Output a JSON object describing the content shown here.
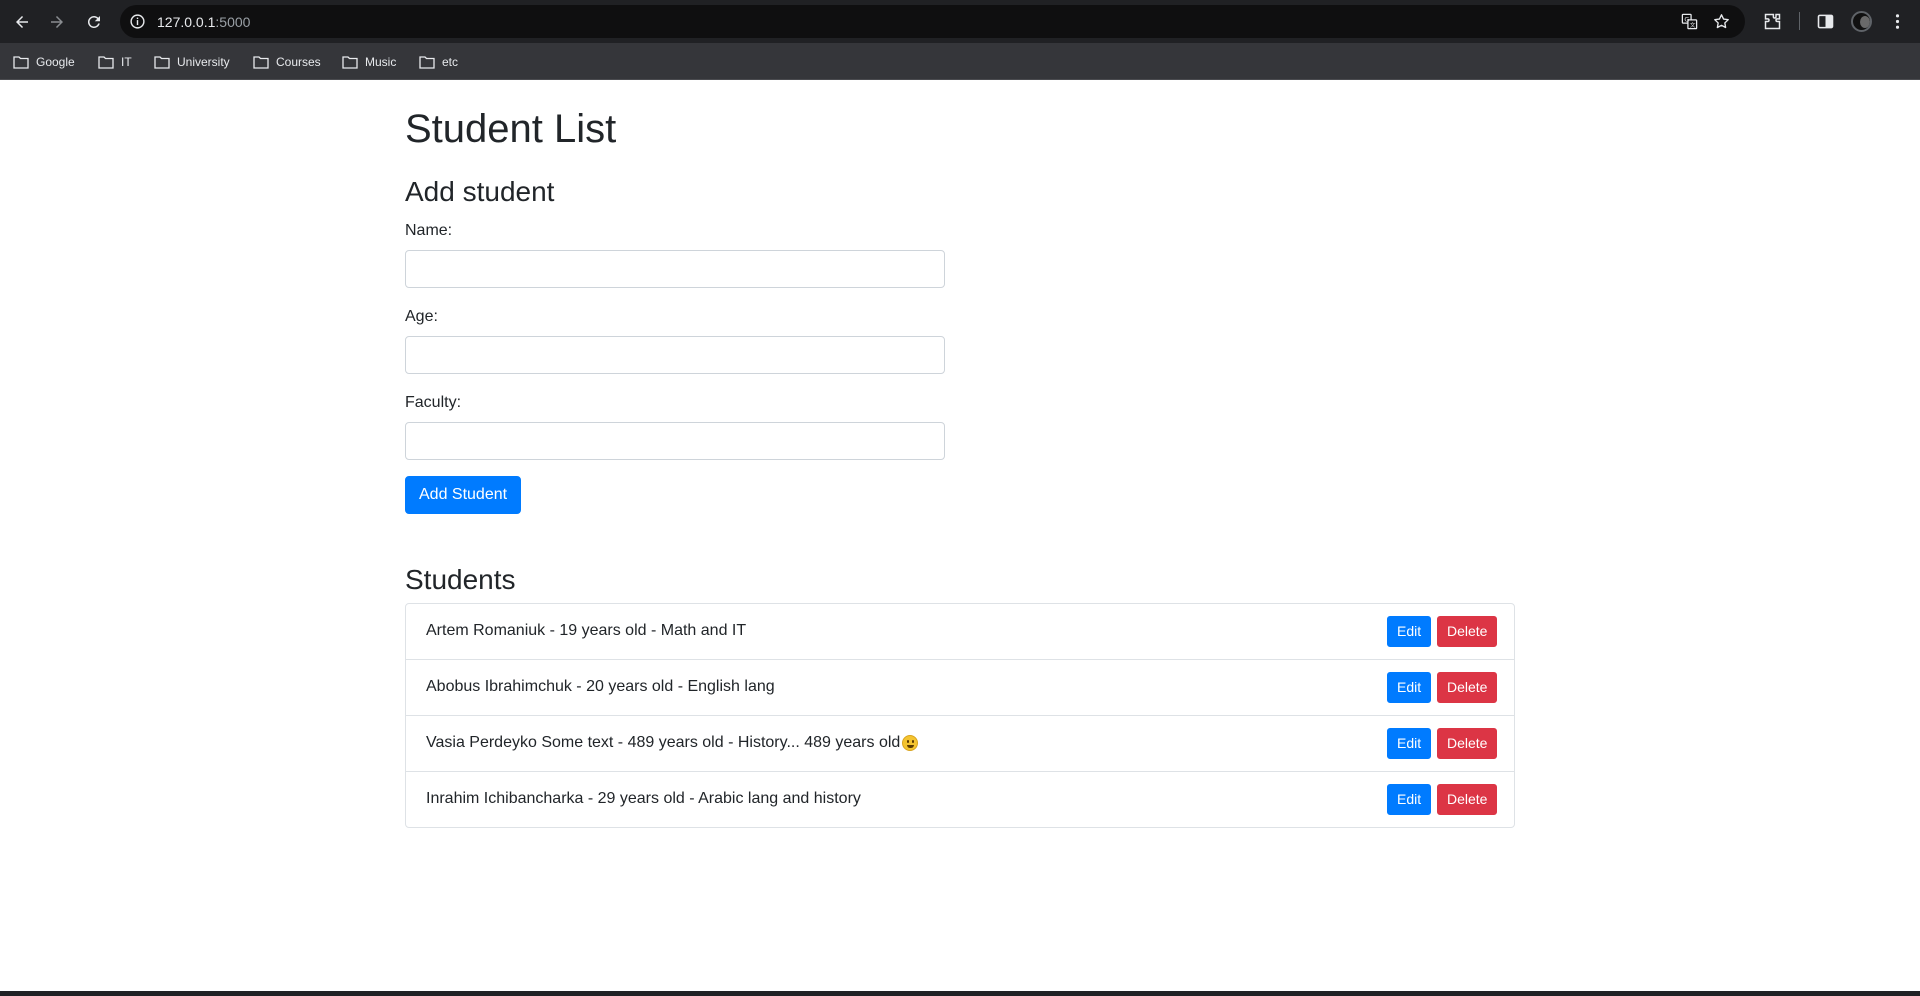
{
  "browser": {
    "url_host": "127.0.0.1",
    "url_port": ":5000",
    "bookmarks": [
      {
        "label": "Google"
      },
      {
        "label": "IT"
      },
      {
        "label": "University"
      },
      {
        "label": "Courses"
      },
      {
        "label": "Music"
      },
      {
        "label": "etc"
      }
    ]
  },
  "page": {
    "title": "Student List",
    "add_heading": "Add student",
    "form": {
      "name_label": "Name:",
      "name_value": "",
      "age_label": "Age:",
      "age_value": "",
      "faculty_label": "Faculty:",
      "faculty_value": "",
      "submit_label": "Add Student"
    },
    "students_heading": "Students",
    "students": [
      {
        "text": "Artem Romaniuk - 19 years old - Math and IT",
        "emoji": false
      },
      {
        "text": "Abobus Ibrahimchuk - 20 years old - English lang",
        "emoji": false
      },
      {
        "text": "Vasia Perdeyko Some text - 489 years old - History... 489 years old",
        "emoji": true
      },
      {
        "text": "Inrahim Ichibancharka - 29 years old - Arabic lang and history",
        "emoji": false
      }
    ],
    "edit_label": "Edit",
    "delete_label": "Delete"
  },
  "colors": {
    "primary": "#007bff",
    "danger": "#dc3545",
    "chrome_bg": "#202124",
    "bookmarks_bg": "#35363a"
  }
}
